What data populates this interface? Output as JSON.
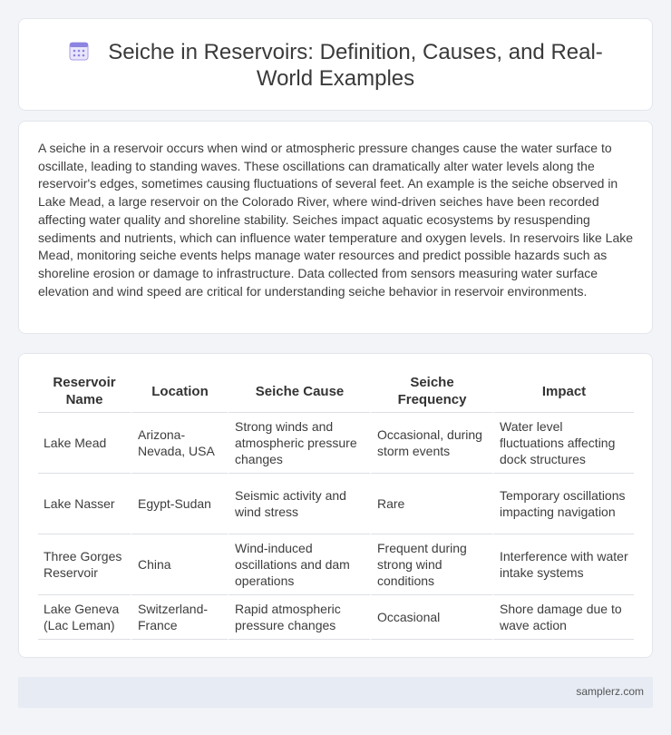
{
  "header": {
    "title": "Seiche in Reservoirs: Definition, Causes, and Real-World Examples",
    "icon": "calendar-icon"
  },
  "description": {
    "text": "A seiche in a reservoir occurs when wind or atmospheric pressure changes cause the water surface to oscillate, leading to standing waves. These oscillations can dramatically alter water levels along the reservoir's edges, sometimes causing fluctuations of several feet. An example is the seiche observed in Lake Mead, a large reservoir on the Colorado River, where wind-driven seiches have been recorded affecting water quality and shoreline stability. Seiches impact aquatic ecosystems by resuspending sediments and nutrients, which can influence water temperature and oxygen levels. In reservoirs like Lake Mead, monitoring seiche events helps manage water resources and predict possible hazards such as shoreline erosion or damage to infrastructure. Data collected from sensors measuring water surface elevation and wind speed are critical for understanding seiche behavior in reservoir environments."
  },
  "table": {
    "headers": [
      "Reservoir Name",
      "Location",
      "Seiche Cause",
      "Seiche Frequency",
      "Impact"
    ],
    "rows": [
      [
        "Lake Mead",
        "Arizona-Nevada, USA",
        "Strong winds and atmospheric pressure changes",
        "Occasional, during storm events",
        "Water level fluctuations affecting dock structures"
      ],
      [
        "Lake Nasser",
        "Egypt-Sudan",
        "Seismic activity and wind stress",
        "Rare",
        "Temporary oscillations impacting navigation"
      ],
      [
        "Three Gorges Reservoir",
        "China",
        "Wind-induced oscillations and dam operations",
        "Frequent during strong wind conditions",
        "Interference with water intake systems"
      ],
      [
        "Lake Geneva (Lac Leman)",
        "Switzerland-France",
        "Rapid atmospheric pressure changes",
        "Occasional",
        "Shore damage due to wave action"
      ]
    ]
  },
  "footer": {
    "site": "samplerz.com"
  },
  "colors": {
    "background": "#f2f4f8",
    "card": "#ffffff",
    "footer": "#e6ebf4",
    "icon_accent": "#7b6fd6"
  }
}
